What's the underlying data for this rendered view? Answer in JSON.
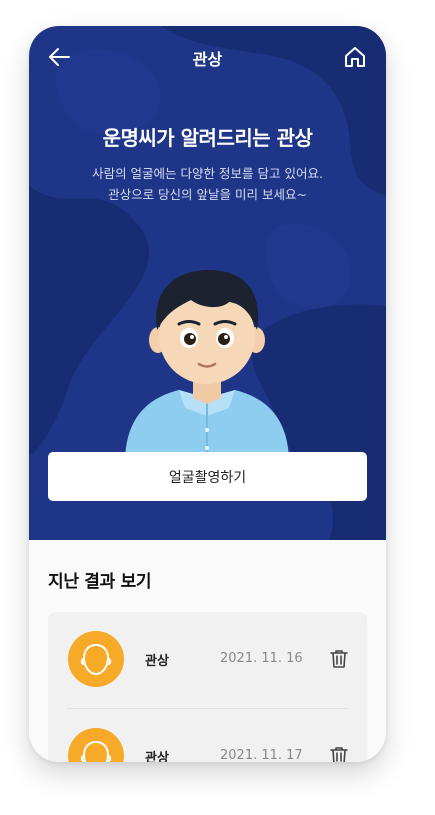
{
  "header": {
    "title": "관상",
    "back_icon": "arrow-left-icon",
    "home_icon": "home-icon"
  },
  "hero": {
    "title": "운명씨가 알려드리는 관상",
    "description_line1": "사람의 얼굴에는 다양한 정보를 담고 있어요.",
    "description_line2": "관상으로 당신의 앞날을 미리 보세요~",
    "capture_button_label": "얼굴촬영하기"
  },
  "history": {
    "title": "지난 결과 보기",
    "items": [
      {
        "label": "관상",
        "date": "2021. 11. 16"
      },
      {
        "label": "관상",
        "date": "2021. 11. 17"
      }
    ]
  },
  "colors": {
    "hero_bg": "#1f3587",
    "accent_orange": "#f7a928",
    "button_bg": "#ffffff"
  }
}
